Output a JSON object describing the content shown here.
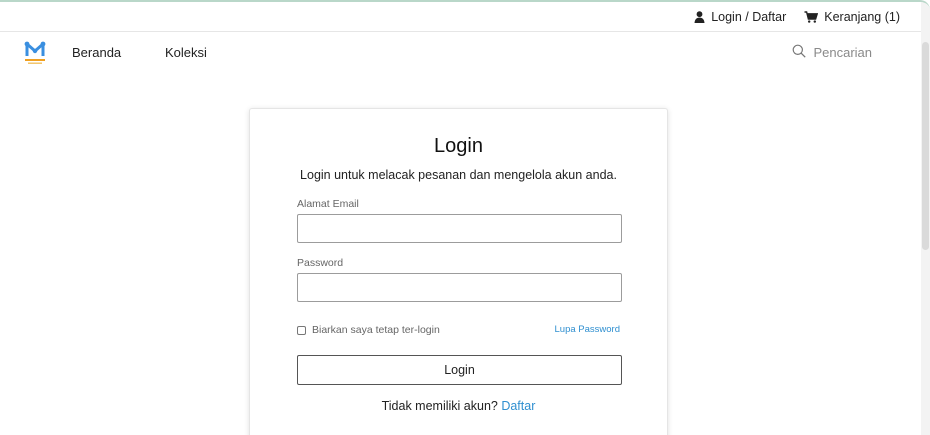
{
  "topbar": {
    "login_label": "Login / Daftar",
    "cart_label": "Keranjang (1)",
    "user_icon": "user-icon",
    "cart_icon": "cart-icon"
  },
  "nav": {
    "logo_icon": "brand-logo-icon",
    "items": [
      {
        "label": "Beranda"
      },
      {
        "label": "Koleksi"
      }
    ],
    "search": {
      "label": "Pencarian",
      "icon": "search-icon"
    }
  },
  "login_form": {
    "title": "Login",
    "subtitle": "Login untuk melacak pesanan dan mengelola akun anda.",
    "email": {
      "label": "Alamat Email",
      "value": ""
    },
    "password": {
      "label": "Password",
      "value": ""
    },
    "remember_label": "Biarkan saya tetap ter-login",
    "remember_checked": false,
    "forgot_label": "Lupa Password",
    "submit_label": "Login",
    "no_account_text": "Tidak memiliki akun?",
    "register_label": "Daftar"
  },
  "colors": {
    "accent_link": "#2f8fd0",
    "logo_blue": "#3a8fe0",
    "logo_orange": "#f0a020",
    "top_border": "#b9d7c9"
  }
}
